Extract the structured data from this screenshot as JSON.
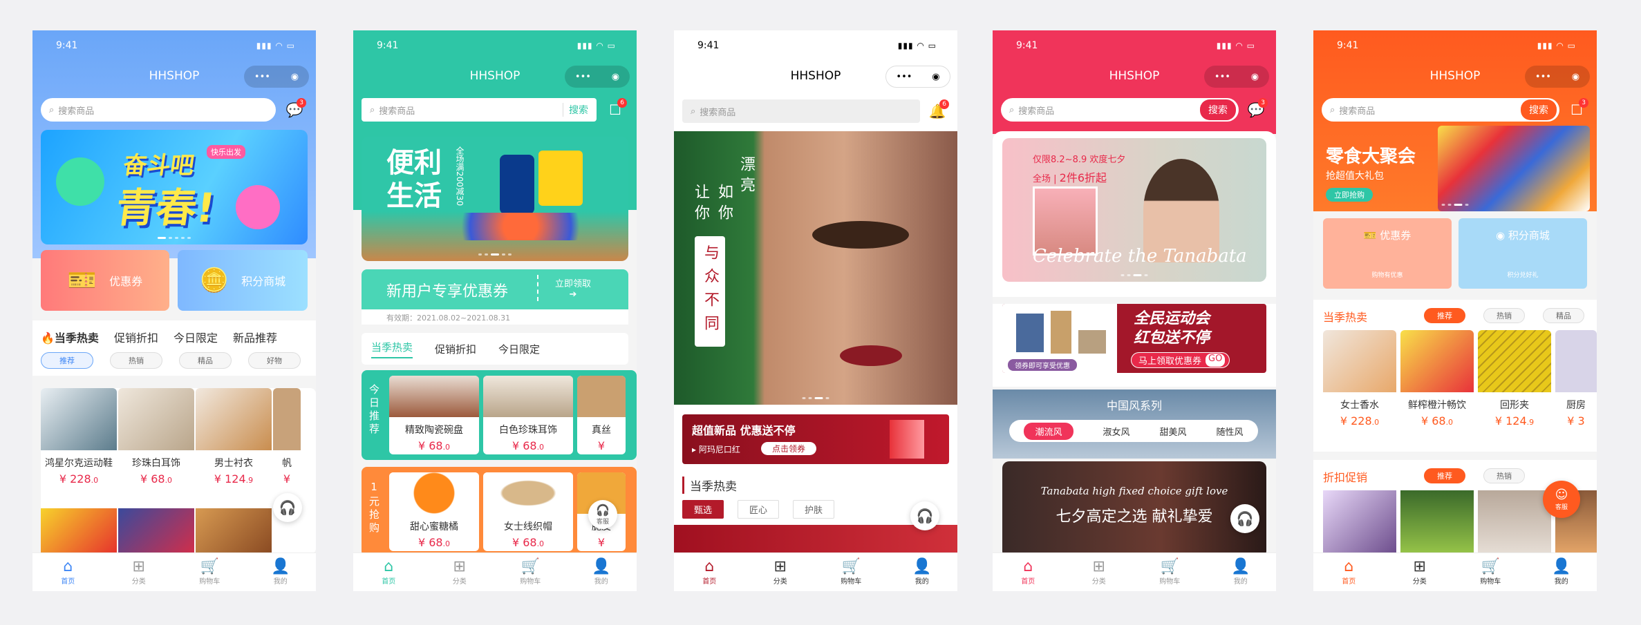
{
  "common": {
    "time": "9:41",
    "status_icons": "▮▮▮ ◠ ▭",
    "app_title": "HHSHOP",
    "capsule_more": "•••",
    "capsule_close": "◉",
    "search_placeholder": "搜索商品",
    "search_btn": "搜索",
    "msg_count": "3",
    "msg_count6": "6",
    "tabs": [
      "首页",
      "分类",
      "购物车",
      "我的"
    ],
    "tab_icons": [
      "⌂",
      "⊞",
      "🛒",
      "👤"
    ]
  },
  "p1": {
    "coupon": "优惠券",
    "points": "积分商城",
    "cats": [
      "当季热卖",
      "促销折扣",
      "今日限定",
      "新品推荐"
    ],
    "chips": [
      "推荐",
      "热销",
      "精品",
      "好物"
    ],
    "banner_a": "奋斗吧",
    "banner_b": "青春!",
    "banner_tag": "快乐出发",
    "products": [
      {
        "name": "鸿星尔克运动鞋",
        "price": "228",
        "dec": ".0"
      },
      {
        "name": "珍珠白耳饰",
        "price": "68",
        "dec": ".0"
      },
      {
        "name": "男士衬衣",
        "price": "124",
        "dec": ".9"
      },
      {
        "name": "帆",
        "price": "¥",
        "dec": ""
      }
    ]
  },
  "p2": {
    "banner_title_a": "便利",
    "banner_title_b": "生活",
    "banner_sub": "全场满200减30",
    "coupon_title": "新用户专享优惠券",
    "coupon_btn": "立即领取",
    "coupon_validity": "有效期：2021.08.02~2021.08.31",
    "cats": [
      "当季热卖",
      "促销折扣",
      "今日限定"
    ],
    "side1": "今日推荐",
    "side2": "1元抢购",
    "products1": [
      {
        "name": "精致陶瓷碗盘",
        "price": "68",
        "dec": ".0"
      },
      {
        "name": "白色珍珠耳饰",
        "price": "68",
        "dec": ".0"
      },
      {
        "name": "真丝",
        "price": "¥",
        "dec": ""
      }
    ],
    "products2": [
      {
        "name": "甜心蜜糖橘",
        "price": "68",
        "dec": ".0"
      },
      {
        "name": "女士线织帽",
        "price": "68",
        "dec": ".0"
      },
      {
        "name": "脆皮",
        "price": "¥",
        "dec": ""
      }
    ],
    "service": "客服"
  },
  "p3": {
    "poem": [
      "漂亮",
      "让你如",
      "与众不同",
      "你"
    ],
    "poem_col1": "漂亮",
    "poem_col2": "如你",
    "poem_col3": "让你",
    "poem_red": "与众不同",
    "promo_title": "超值新品 优惠送不停",
    "promo_sub": "阿玛尼口红",
    "promo_btn": "点击领券",
    "section": "当季热卖",
    "chips": [
      "甄选",
      "匠心",
      "护肤"
    ]
  },
  "p4": {
    "banner_top": "仅限8.2~8.9 欢度七夕",
    "banner_tag": "全场",
    "banner_deal": "2件6折起",
    "banner_script": "Celebrate the Tanabata",
    "promo_a": "全民运动会",
    "promo_b": "红包送不停",
    "promo_btn": "马上领取优惠券",
    "promo_go": "GO",
    "promo_cap": "领券即可享受优惠",
    "style_title": "中国风系列",
    "styles": [
      "潮流风",
      "淑女风",
      "甜美风",
      "随性风"
    ],
    "gift_script": "Tanabata high fixed choice gift love",
    "gift_cn": "七夕高定之选 献礼挚爱"
  },
  "p5": {
    "banner_title": "零食大聚会",
    "banner_sub": "抢超值大礼包",
    "banner_btn": "立即抢购",
    "coupon": "优惠券",
    "coupon_sub": "购物有优惠",
    "points": "积分商城",
    "points_sub": "积分兑好礼",
    "hot": "当季热卖",
    "hot_chips": [
      "推荐",
      "热销",
      "精品"
    ],
    "products": [
      {
        "name": "女士香水",
        "price": "228",
        "dec": ".0"
      },
      {
        "name": "鲜榨橙汁畅饮",
        "price": "68",
        "dec": ".0"
      },
      {
        "name": "回形夹",
        "price": "124",
        "dec": ".9"
      },
      {
        "name": "厨房",
        "price": "¥ 3",
        "dec": ""
      }
    ],
    "discount": "折扣促销",
    "disc_chips": [
      "推荐",
      "热销"
    ],
    "service": "客服"
  },
  "colors": {
    "blue": "#6aa6f8",
    "teal": "#2ec6a6",
    "red": "#f0345a",
    "orange": "#ff5a1f",
    "dark_red": "#a3172a"
  }
}
